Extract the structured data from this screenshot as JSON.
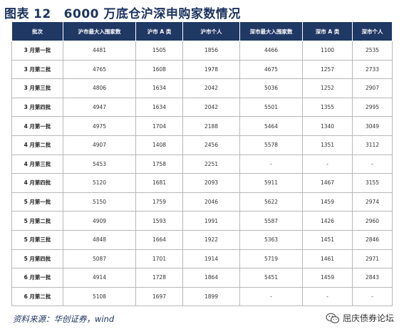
{
  "title": {
    "prefix": "图表",
    "number": "12",
    "text": "6000 万底仓沪深申购家数情况"
  },
  "table": {
    "headers": [
      "批次",
      "沪市最大入围家数",
      "沪市 A 类",
      "沪市个人",
      "深市最大入围家数",
      "深市 A 类",
      "深市个人"
    ],
    "rows": [
      [
        "3 月第一批",
        "4481",
        "1505",
        "1856",
        "4466",
        "1100",
        "2535"
      ],
      [
        "3 月第二批",
        "4765",
        "1608",
        "1978",
        "4675",
        "1257",
        "2733"
      ],
      [
        "3 月第三批",
        "4806",
        "1634",
        "2042",
        "5036",
        "1252",
        "2907"
      ],
      [
        "3 月第四批",
        "4947",
        "1634",
        "2042",
        "5501",
        "1355",
        "2995"
      ],
      [
        "4 月第一批",
        "4975",
        "1704",
        "2188",
        "5464",
        "1340",
        "3049"
      ],
      [
        "4 月第二批",
        "4907",
        "1408",
        "2456",
        "5578",
        "1351",
        "3112"
      ],
      [
        "4 月第三批",
        "5453",
        "1758",
        "2251",
        "-",
        "-",
        "-"
      ],
      [
        "4 月第四批",
        "5120",
        "1681",
        "2093",
        "5911",
        "1467",
        "3155"
      ],
      [
        "5 月第一批",
        "5150",
        "1759",
        "2046",
        "5622",
        "1459",
        "2974"
      ],
      [
        "5 月第二批",
        "4909",
        "1593",
        "1991",
        "5587",
        "1426",
        "2960"
      ],
      [
        "5 月第三批",
        "4848",
        "1664",
        "1922",
        "5363",
        "1451",
        "2846"
      ],
      [
        "5 月第四批",
        "5087",
        "1701",
        "1914",
        "5719",
        "1461",
        "2971"
      ],
      [
        "6 月第一批",
        "4914",
        "1728",
        "1864",
        "5451",
        "1459",
        "2843"
      ],
      [
        "6 月第二批",
        "5108",
        "1697",
        "1899",
        "-",
        "-",
        "-"
      ]
    ]
  },
  "source": "资料来源：华创证券，wind",
  "brand": {
    "name": "屈庆债券论坛",
    "icon": "wechat-icon"
  },
  "colors": {
    "header_bg": "#1f3864",
    "title": "#1d3461",
    "border": "#b8b8b8"
  }
}
